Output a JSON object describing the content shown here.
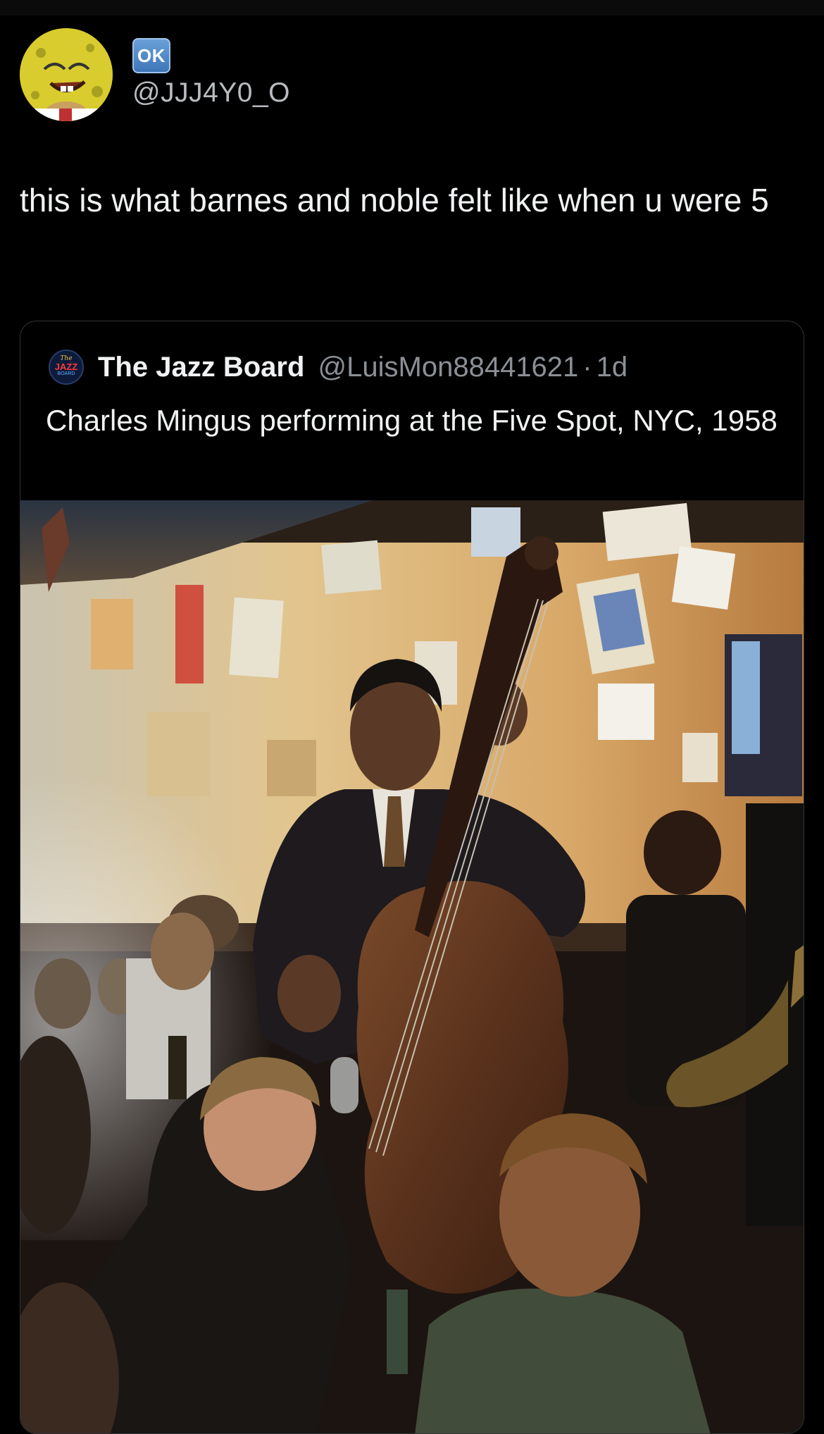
{
  "post": {
    "badge": "OK",
    "handle": "@JJJ4Y0_O",
    "text": "this is what barnes and noble felt like when u were 5",
    "avatar_icon": "spongebob-avatar-icon"
  },
  "quote": {
    "avatar_icon": "jazz-board-logo-icon",
    "avatar_logo_text": {
      "the": "The",
      "jazz": "JAZZ",
      "board": "BOARD"
    },
    "name": "The Jazz Board",
    "handle": "@LuisMon88441621",
    "separator": "·",
    "time": "1d",
    "text": "Charles Mingus performing at the Five Spot, NYC, 1958",
    "media_icon": "jazz-club-photo"
  },
  "colors": {
    "background": "#000000",
    "text_primary": "#f1f2f3",
    "text_secondary": "#8b9096",
    "card_border": "#2f3336",
    "badge_blue": "#3f76b8"
  }
}
